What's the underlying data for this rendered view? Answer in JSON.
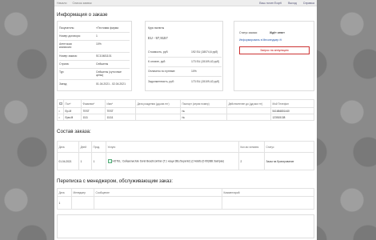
{
  "topbar": {
    "left": [
      "Начало",
      "Список заявок"
    ],
    "right": [
      "Ваш логин Ecqrtl",
      "Выход",
      "Справка"
    ]
  },
  "info": {
    "title": "Информация о заказе",
    "left": [
      {
        "k": "Покупатель:",
        "v": "«Тестовая фирма"
      },
      {
        "k": "Номер договора:",
        "v": "1"
      },
      {
        "k": "Агентская комиссия:",
        "v": "10%"
      },
      {
        "k": "Номер заказа:",
        "v": "SC10481101"
      },
      {
        "k": "Страна:",
        "v": "Сейшелы"
      },
      {
        "k": "Тур:",
        "v": "Сейшелы (суточные цены)"
      },
      {
        "k": "Заезд:",
        "v": "01.04.2021 - 02.04.2021"
      }
    ],
    "mid_header": "Курс валюты",
    "mid_rate": "EU - 97,9157",
    "mid": [
      {
        "k": "Стоимость, руб:",
        "v": "192 EU (18074,6 руб)"
      },
      {
        "k": "К оплате, руб:",
        "v": "173 EU (15109,42 руб)"
      },
      {
        "k": "Оплачено по путевке:",
        "v": "10%"
      },
      {
        "k": "Задолженность, руб:",
        "v": "173 EU (15109,42 руб)"
      }
    ],
    "status_label": "Статус заказа:",
    "status_value": "Ждёт ответ",
    "status_link": "Информировать в Мессенджер",
    "annul_button": "Запрос на аннуляцию"
  },
  "tourists": {
    "headers": [
      "",
      "Пол*",
      "Фамилия*",
      "Имя*",
      "Дата рождения (дд.мм.гггг)",
      "Паспорт (серия номер)",
      "Действителен до (дд.мм.гггг)",
      "Мой Телефон"
    ],
    "rows": [
      [
        "",
        "Ер-М",
        "TEST",
        "TEST",
        "",
        "№",
        "",
        "541684801440"
      ],
      [
        "",
        "Ерм-М",
        "1111",
        "11111",
        "",
        "№",
        "",
        "123515138"
      ]
    ]
  },
  "order": {
    "title": "Состав заказа:",
    "headers": [
      "Дата",
      "Дней",
      "Прод.",
      "Услуги",
      "Кол-во человек",
      "Статус"
    ],
    "row": [
      "01.04.2021",
      "1",
      "1",
      "HOTEL: Сейшелы/Jule Sorel Beachcomber (Т.1 нощи 3BL/Superior) (2 Adults (0-99)/BB Завтрак)",
      "2",
      "Заказ на бронирование"
    ]
  },
  "messages": {
    "title": "Переписка с менеджером, обслуживающим заказ:",
    "headers": [
      "Дата",
      "Менеджер",
      "Сообщение",
      "Комментарий"
    ],
    "row": [
      "1",
      "",
      "",
      ""
    ]
  }
}
